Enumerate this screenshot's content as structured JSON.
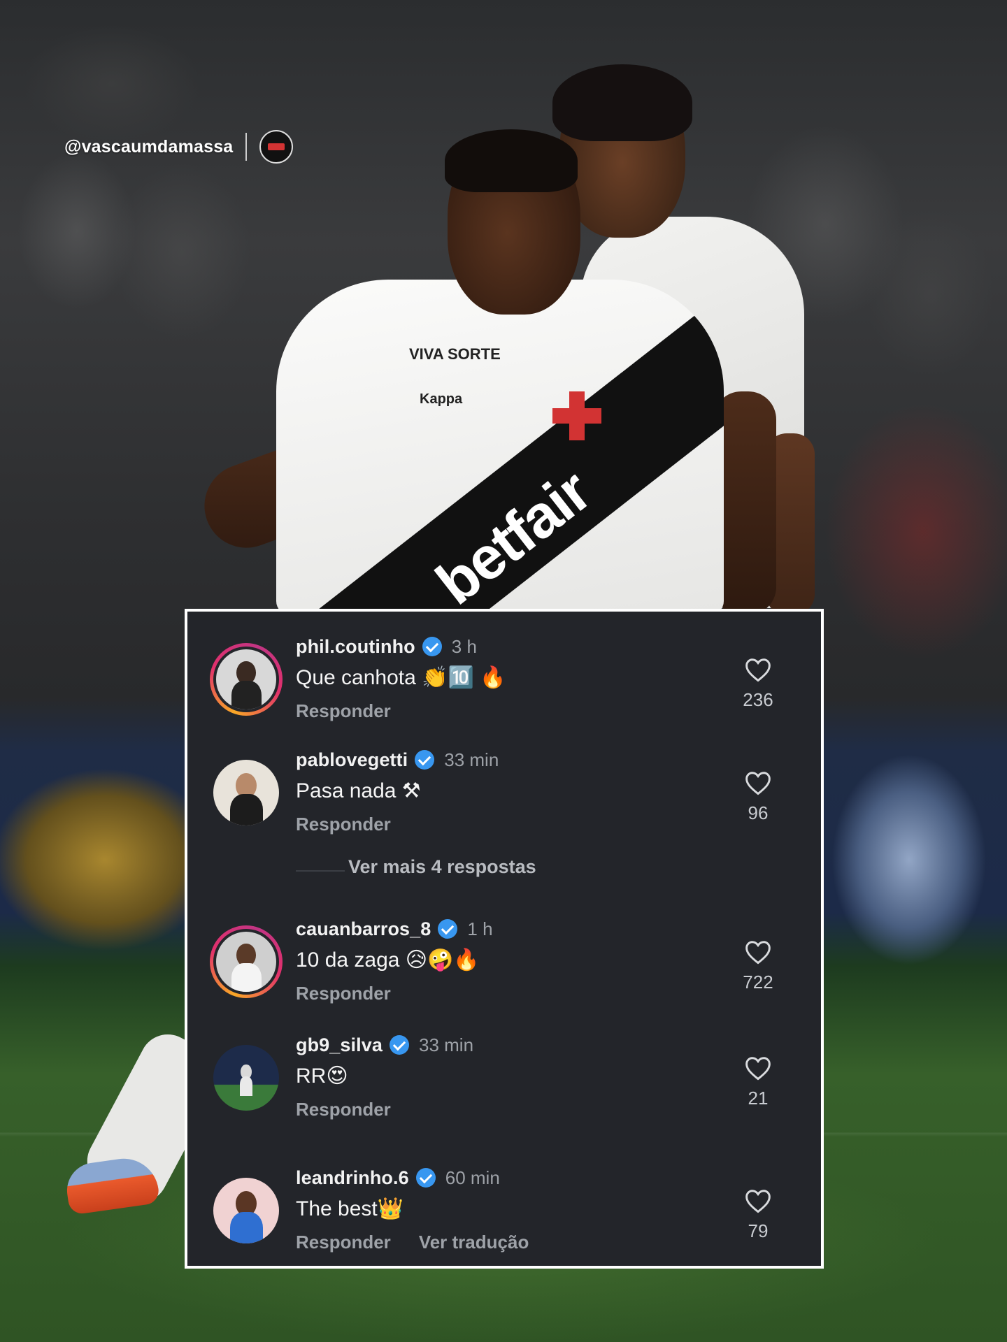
{
  "watermark": {
    "handle": "@vascaumdamassa"
  },
  "photo": {
    "shirt_sponsor_top": "VIVA SORTE",
    "shirt_brand": "Kappa",
    "shirt_sponsor_main": "betfair"
  },
  "comments": [
    {
      "username": "phil.coutinho",
      "verified": true,
      "time": "3 h",
      "text": "Que canhota 👏🔟 🔥",
      "reply": "Responder",
      "likes": "236",
      "story_ring": true
    },
    {
      "username": "pablovegetti",
      "verified": true,
      "time": "33 min",
      "text": "Pasa nada ⚒",
      "reply": "Responder",
      "likes": "96",
      "story_ring": false
    },
    {
      "username": "cauanbarros_8",
      "verified": true,
      "time": "1 h",
      "text": "10 da zaga 😥🤪🔥",
      "reply": "Responder",
      "likes": "722",
      "story_ring": true
    },
    {
      "username": "gb9_silva",
      "verified": true,
      "time": "33 min",
      "text": "RR😍",
      "reply": "Responder",
      "likes": "21",
      "story_ring": false
    },
    {
      "username": "leandrinho.6",
      "verified": true,
      "time": "60 min",
      "text": "The best👑",
      "reply": "Responder",
      "translate": "Ver tradução",
      "likes": "79",
      "story_ring": false
    }
  ],
  "more_replies": "Ver mais 4 respostas",
  "colors": {
    "panel_bg": "#23252a",
    "verified_blue": "#3897f0",
    "secondary_text": "#9ea2a8"
  }
}
